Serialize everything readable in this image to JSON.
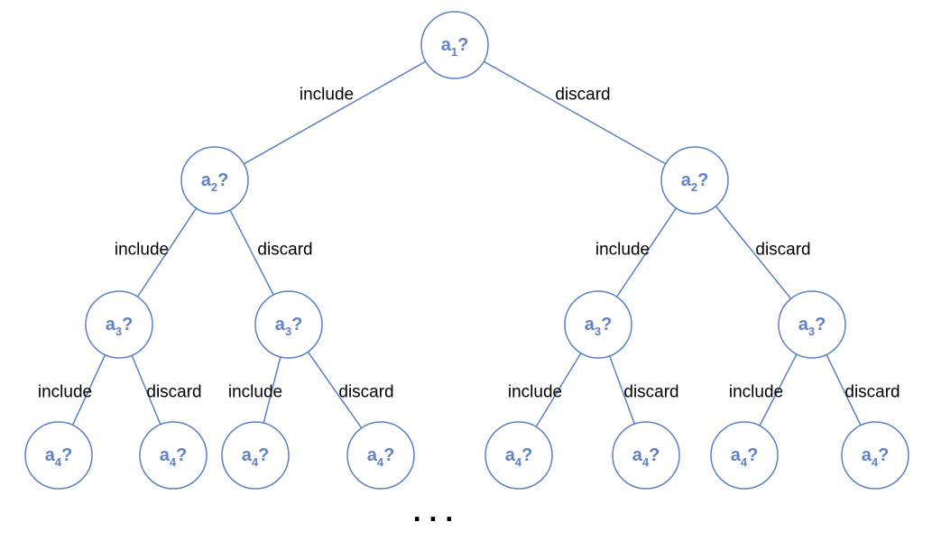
{
  "labels": {
    "include": "include",
    "discard": "discard"
  },
  "nodes": {
    "root": {
      "a": "a",
      "sub": "1",
      "q": "?"
    },
    "l2": {
      "a": "a",
      "sub": "2",
      "q": "?"
    },
    "l3": {
      "a": "a",
      "sub": "3",
      "q": "?"
    },
    "l4": {
      "a": "a",
      "sub": "4",
      "q": "?"
    }
  },
  "ellipsis": ". . .",
  "chart_data": {
    "type": "tree",
    "description": "Binary decision tree over attributes a1..a4; each node asks whether to include or discard the current attribute.",
    "levels": [
      {
        "depth": 0,
        "attribute": "a1",
        "node_count": 1
      },
      {
        "depth": 1,
        "attribute": "a2",
        "node_count": 2
      },
      {
        "depth": 2,
        "attribute": "a3",
        "node_count": 4
      },
      {
        "depth": 3,
        "attribute": "a4",
        "node_count": 8
      }
    ],
    "edge_labels": {
      "left": "include",
      "right": "discard"
    },
    "truncated": true
  },
  "colors": {
    "node_stroke": "#5b7fc7",
    "node_text": "#6080c8",
    "edge": "#5b7fc7",
    "label": "#000000"
  }
}
